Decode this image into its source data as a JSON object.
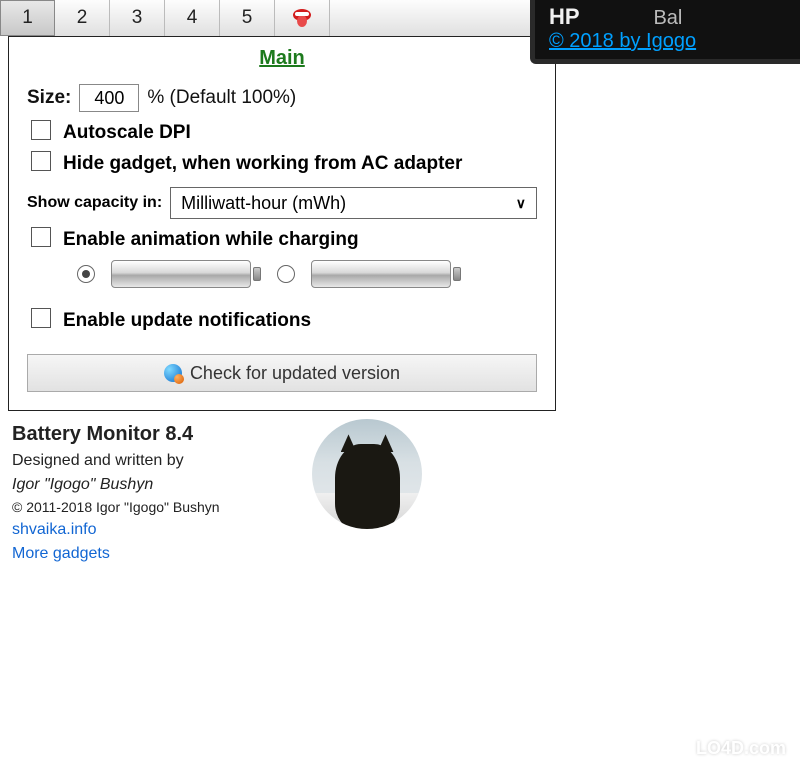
{
  "tabs": {
    "t1": "1",
    "t2": "2",
    "t3": "3",
    "t4": "4",
    "t5": "5",
    "dollar": "$"
  },
  "overlay": {
    "hp": "HP",
    "bal": "Bal",
    "credit": "© 2018 by Igogo"
  },
  "heading": "Main",
  "size": {
    "label": "Size:",
    "value": "400",
    "suffix": "%  (Default 100%)"
  },
  "options": {
    "autoscale": "Autoscale DPI",
    "hide_gadget": "Hide gadget, when working from AC adapter",
    "capacity_label": "Show capacity in:",
    "capacity_value": "Milliwatt-hour (mWh)",
    "enable_anim": "Enable animation while charging",
    "enable_update": "Enable update notifications"
  },
  "check_button": "Check for updated version",
  "about": {
    "title": "Battery Monitor 8.4",
    "designed": "Designed and written by",
    "author": "Igor \"Igogo\" Bushyn",
    "copyright": "© 2011-2018 Igor \"Igogo\" Bushyn",
    "link1": "shvaika.info",
    "link2": "More gadgets"
  },
  "watermark": "LO4D.com"
}
